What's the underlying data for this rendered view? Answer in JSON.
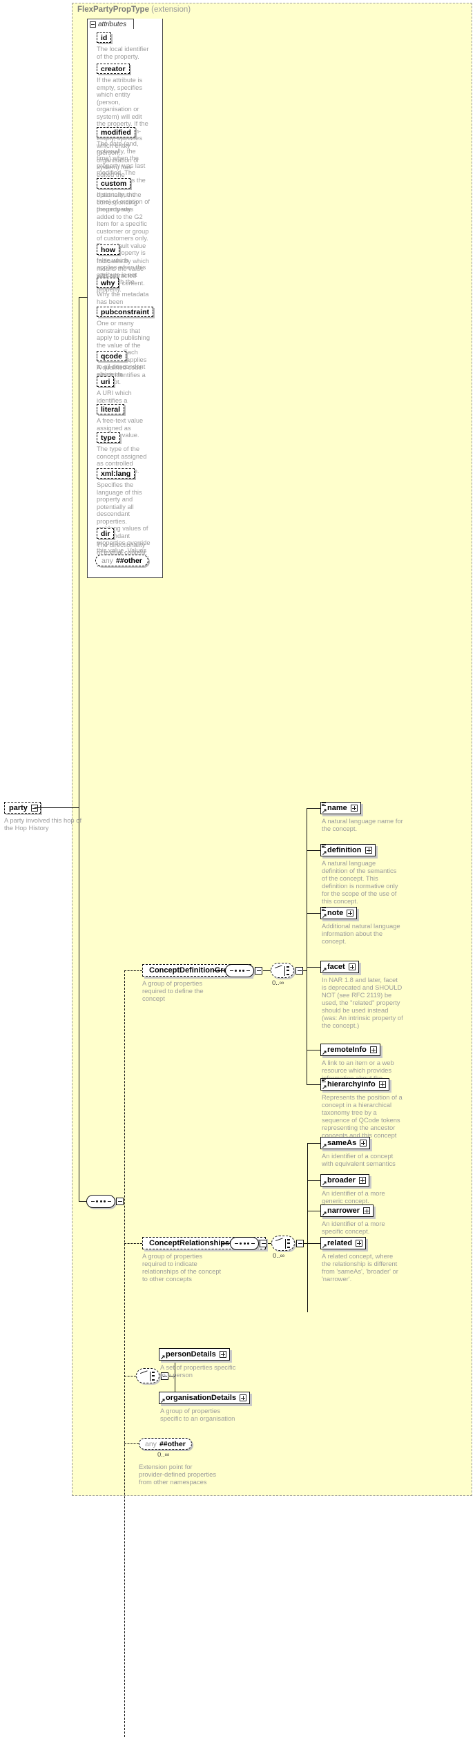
{
  "type_header": {
    "name": "FlexPartyPropType",
    "extension": "(extension)"
  },
  "attributes_panel": {
    "tab_label": "attributes",
    "toggle_icon": "minus-icon",
    "items": [
      {
        "name": "id",
        "desc": "The local identifier of the property."
      },
      {
        "name": "creator",
        "desc": "If the attribute is empty, specifies which entity (person, organisation or system) will edit the property. If the attribute is non-empty, specifies which entity (person, organisation or system) has edited the property."
      },
      {
        "name": "modified",
        "desc": "The date (and, optionally, the time) when the property was last modified. The initial value is the date (and, optionally, the time) of creation of the property."
      },
      {
        "name": "custom",
        "desc": "If set to true the corresponding property was added to the G2 Item for a specific customer or group of customers only. The default value of this property is false which applies when this attribute is not used with the property."
      },
      {
        "name": "how",
        "desc": "Indicates by which means the value was extracted from the content."
      },
      {
        "name": "why",
        "desc": "Why the metadata has been included."
      },
      {
        "name": "pubconstraint",
        "desc": "One or many constraints that apply to publishing the value of the property. Each constraint applies to all descendant elements."
      },
      {
        "name": "qcode",
        "desc": "A qualified code which identifies a concept."
      },
      {
        "name": "uri",
        "desc": "A URI which identifies a concept."
      },
      {
        "name": "literal",
        "desc": "A free-text value assigned as property value."
      },
      {
        "name": "type",
        "desc": "The type of the concept assigned as controlled property value."
      },
      {
        "name": "xml:lang",
        "desc": "Specifies the language of this property and potentially all descendant properties. xml:lang values of descendant properties override this value. Values are determined by Internet BCP 47."
      },
      {
        "name": "dir",
        "desc": "The directionality of textual content."
      }
    ],
    "any_other": {
      "any": "any",
      "ns": "##other"
    }
  },
  "party_node": {
    "label": "party",
    "desc": "A party involved this hop of the Hop History",
    "toggle_icon": "minus-icon"
  },
  "groups": {
    "concept_definition": {
      "label": "ConceptDefinitionGroup",
      "desc": "A group of properties required to define the concept",
      "cardinality": "0..∞",
      "children": [
        {
          "name": "name",
          "desc": "A natural language name for the concept."
        },
        {
          "name": "definition",
          "desc": "A natural language definition of the semantics of the concept. This definition is normative only for the scope of the use of this concept."
        },
        {
          "name": "note",
          "desc": "Additional natural language information about the concept."
        },
        {
          "name": "facet",
          "desc": "In NAR 1.8 and later, facet is deprecated and SHOULD NOT (see RFC 2119) be used, the \"related\" property should be used instead (was: An intrinsic property of the concept.)"
        },
        {
          "name": "remoteInfo",
          "desc": "A link to an item or a web resource which provides information about the concept"
        },
        {
          "name": "hierarchyInfo",
          "desc": "Represents the position of a concept in a hierarchical taxonomy tree by a sequence of QCode tokens representing the ancestor concepts and this concept"
        }
      ]
    },
    "concept_relationships": {
      "label": "ConceptRelationshipsGroup",
      "desc": "A group of properties required to indicate relationships of the concept to other concepts",
      "cardinality": "0..∞",
      "children": [
        {
          "name": "sameAs",
          "desc": "An identifier of a concept with equivalent semantics"
        },
        {
          "name": "broader",
          "desc": "An identifier of a more generic concept."
        },
        {
          "name": "narrower",
          "desc": "An identifier of a more specific concept."
        },
        {
          "name": "related",
          "desc": "A related concept, where the relationship is different from 'sameAs', 'broader' or 'narrower'."
        }
      ]
    },
    "details_choice": {
      "children": [
        {
          "name": "personDetails",
          "desc": "A set of properties specific to a person"
        },
        {
          "name": "organisationDetails",
          "desc": "A group of properties specific to an organisation"
        }
      ]
    },
    "any_other": {
      "any": "any",
      "ns": "##other",
      "cardinality": "0..∞",
      "desc": "Extension point for provider-defined properties from other namespaces"
    }
  },
  "colors": {
    "panel_bg": "#ffffcc",
    "box_bg": "#ffffff",
    "desc_text": "#9b9b9b",
    "line": "#111111",
    "header_text": "#7a7a7a"
  }
}
